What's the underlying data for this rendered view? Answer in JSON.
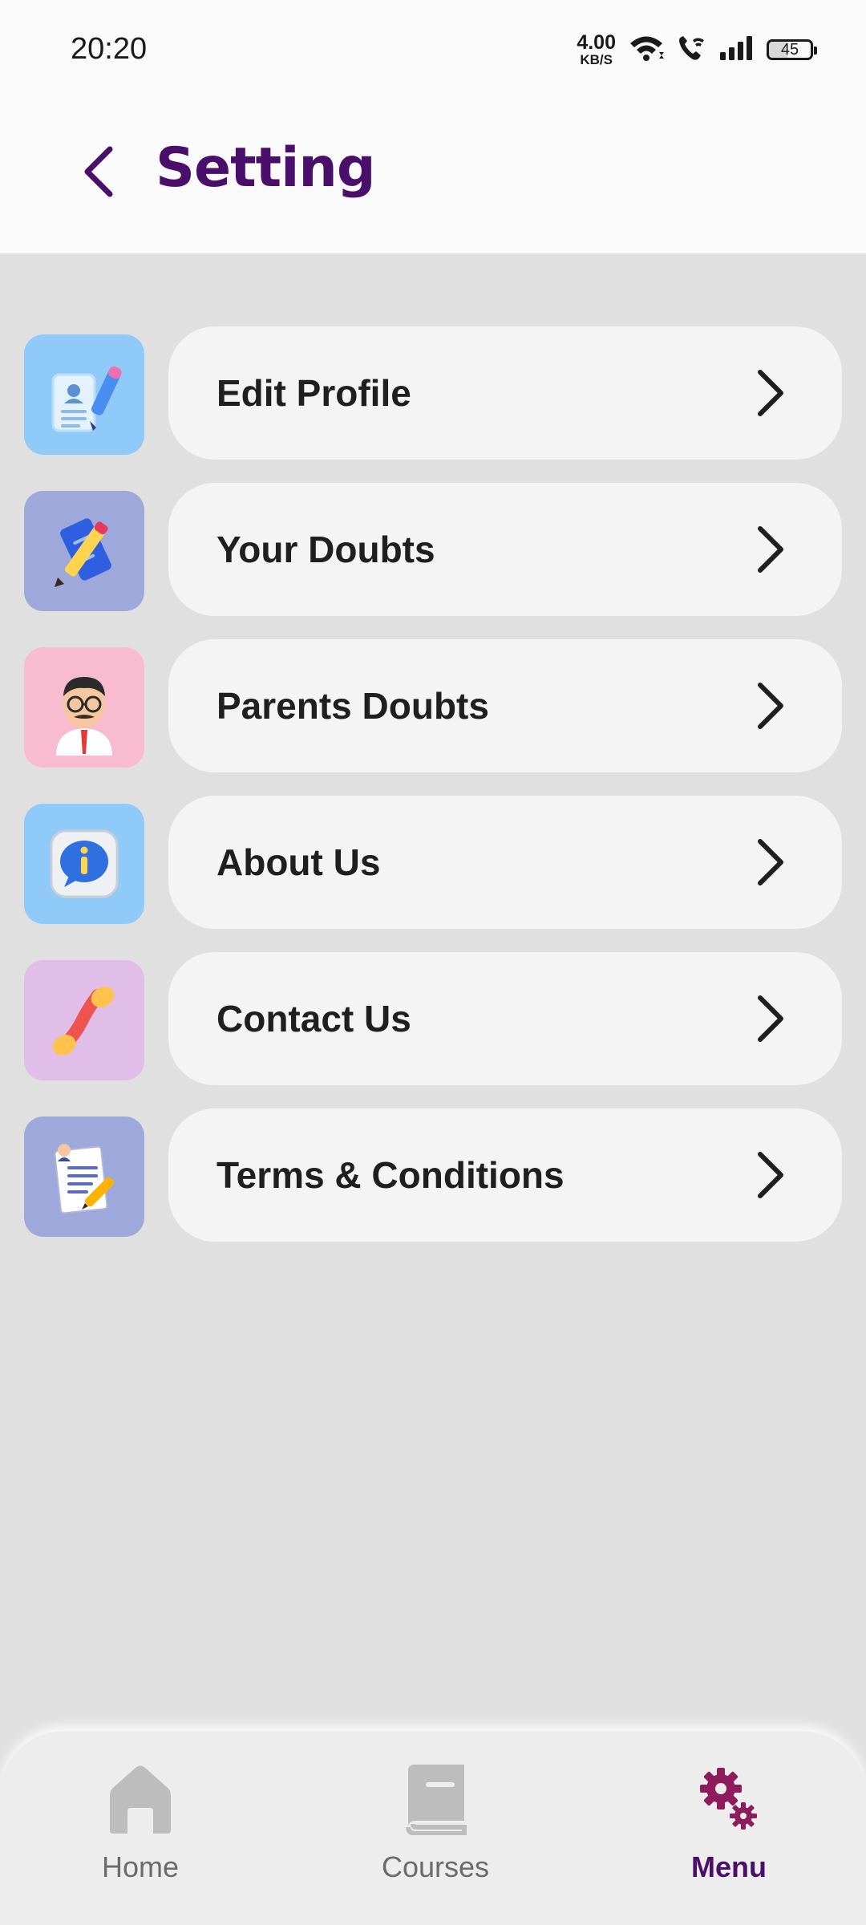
{
  "status_bar": {
    "time": "20:20",
    "net_speed_value": "4.00",
    "net_speed_unit": "KB/S",
    "battery": "45"
  },
  "header": {
    "title": "Setting"
  },
  "menu": {
    "items": [
      {
        "label": "Edit Profile",
        "icon": "profile-edit-icon",
        "icon_bg": "#90caf9"
      },
      {
        "label": "Your Doubts",
        "icon": "pencil-notes-icon",
        "icon_bg": "#9fa8da"
      },
      {
        "label": "Parents Doubts",
        "icon": "parent-avatar-icon",
        "icon_bg": "#f8bbd0"
      },
      {
        "label": "About Us",
        "icon": "info-icon",
        "icon_bg": "#90caf9"
      },
      {
        "label": "Contact Us",
        "icon": "phone-icon",
        "icon_bg": "#e1bee7"
      },
      {
        "label": "Terms & Conditions",
        "icon": "document-pen-icon",
        "icon_bg": "#9fa8da"
      }
    ]
  },
  "bottom_nav": {
    "items": [
      {
        "label": "Home",
        "icon": "home-icon",
        "active": false
      },
      {
        "label": "Courses",
        "icon": "book-icon",
        "active": false
      },
      {
        "label": "Menu",
        "icon": "gears-icon",
        "active": true
      }
    ]
  },
  "colors": {
    "brand": "#4a0f6a",
    "accent_icon": "#8e1b5b",
    "background": "#e0e0e0",
    "card": "#f4f4f4"
  }
}
